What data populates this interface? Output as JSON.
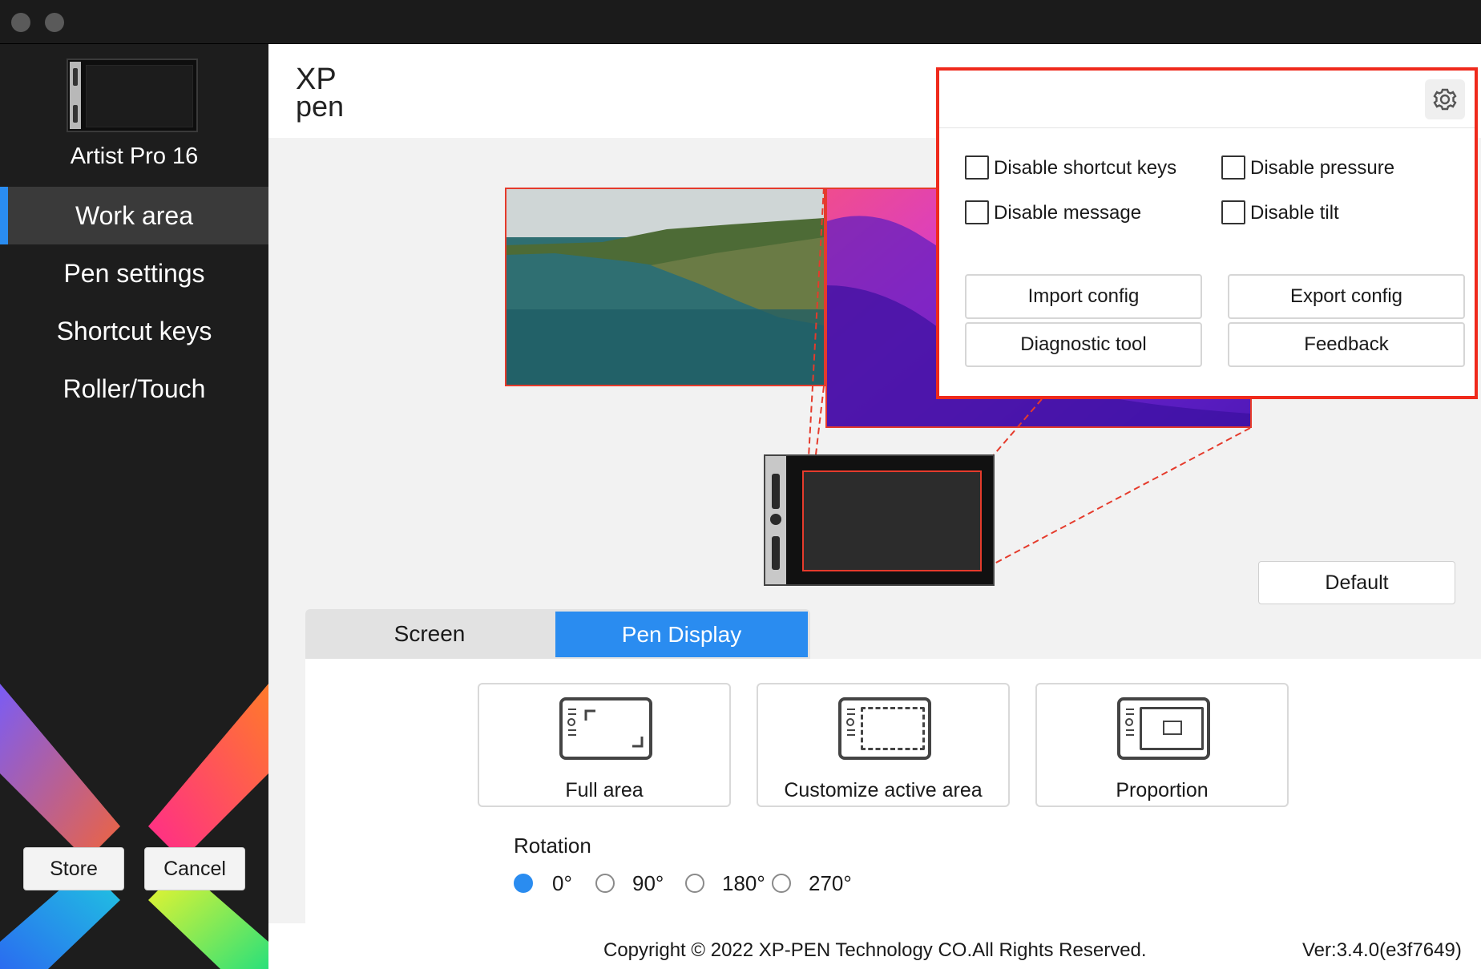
{
  "window": {
    "traffic_lights": [
      "close",
      "minimize"
    ]
  },
  "sidebar": {
    "device_name": "Artist Pro 16",
    "items": [
      {
        "label": "Work area",
        "active": true
      },
      {
        "label": "Pen settings",
        "active": false
      },
      {
        "label": "Shortcut keys",
        "active": false
      },
      {
        "label": "Roller/Touch",
        "active": false
      }
    ],
    "store_label": "Store",
    "cancel_label": "Cancel",
    "accent_color": "#2a8cf0"
  },
  "header": {
    "logo_top": "XP",
    "logo_bottom": "pen"
  },
  "work_area": {
    "default_label": "Default",
    "tabs": [
      {
        "label": "Screen",
        "selected": false
      },
      {
        "label": "Pen Display",
        "selected": true
      }
    ],
    "modes": [
      {
        "label": "Full area",
        "icon": "full-area-icon"
      },
      {
        "label": "Customize active area",
        "icon": "custom-area-icon"
      },
      {
        "label": "Proportion",
        "icon": "proportion-icon"
      }
    ],
    "rotation": {
      "title": "Rotation",
      "options": [
        "0°",
        "90°",
        "180°",
        "270°"
      ],
      "selected": "0°"
    }
  },
  "settings_popup": {
    "checkboxes": [
      {
        "label": "Disable shortcut keys",
        "checked": false
      },
      {
        "label": "Disable pressure",
        "checked": false
      },
      {
        "label": "Disable message",
        "checked": false
      },
      {
        "label": "Disable tilt",
        "checked": false
      }
    ],
    "buttons": {
      "import": "Import config",
      "export": "Export config",
      "diagnostic": "Diagnostic tool",
      "feedback": "Feedback"
    },
    "highlight_color": "#ef2a1c"
  },
  "footer": {
    "copyright": "Copyright © 2022  XP-PEN Technology CO.All Rights Reserved.",
    "version": "Ver:3.4.0(e3f7649)"
  }
}
